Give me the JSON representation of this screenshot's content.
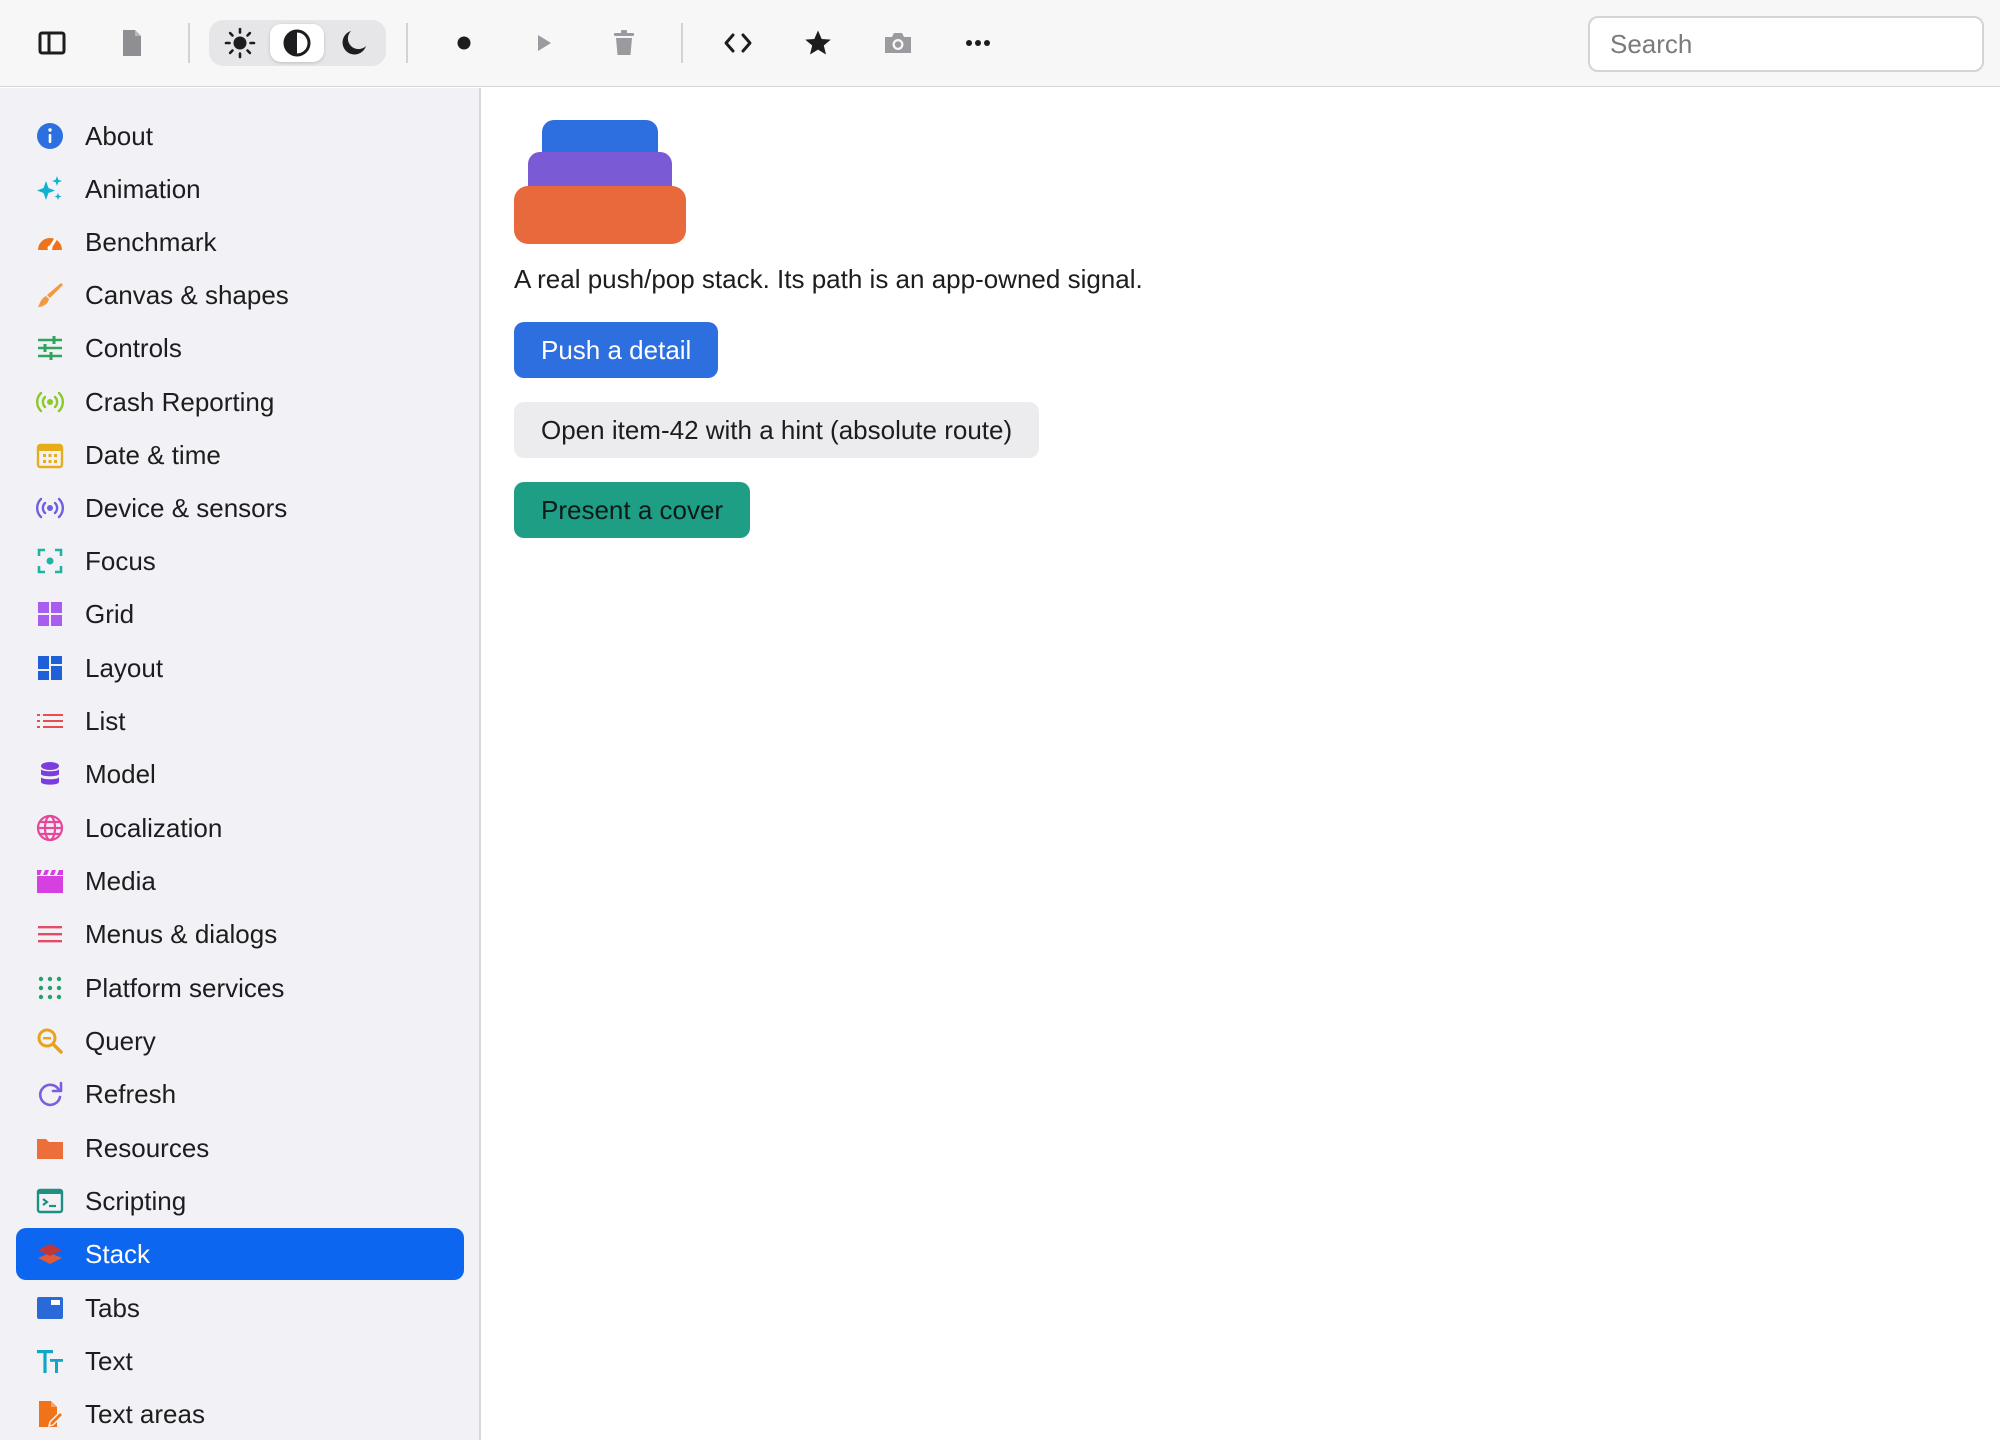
{
  "toolbar": {
    "search_placeholder": "Search",
    "buttons": [
      {
        "name": "sidebar-toggle",
        "icon": "sidebar-icon"
      },
      {
        "name": "document",
        "icon": "document-icon"
      },
      {
        "name": "record",
        "icon": "record-dot-icon"
      },
      {
        "name": "play",
        "icon": "play-icon"
      },
      {
        "name": "delete",
        "icon": "trash-icon"
      },
      {
        "name": "source",
        "icon": "code-brackets-icon"
      },
      {
        "name": "favorite",
        "icon": "star-icon"
      },
      {
        "name": "screenshot",
        "icon": "camera-icon"
      },
      {
        "name": "more",
        "icon": "ellipsis-icon"
      }
    ],
    "theme_options": [
      {
        "name": "light",
        "icon": "sun-icon",
        "selected": false
      },
      {
        "name": "auto",
        "icon": "contrast-icon",
        "selected": true
      },
      {
        "name": "dark",
        "icon": "moon-icon",
        "selected": false
      }
    ]
  },
  "sidebar": {
    "selected_index": 21,
    "items": [
      {
        "label": "About",
        "icon": "info-icon",
        "color": "#2c6fdf"
      },
      {
        "label": "Animation",
        "icon": "sparkles-icon",
        "color": "#12b2cf"
      },
      {
        "label": "Benchmark",
        "icon": "speedometer-icon",
        "color": "#f07219"
      },
      {
        "label": "Canvas & shapes",
        "icon": "paintbrush-icon",
        "color": "#f19a3e"
      },
      {
        "label": "Controls",
        "icon": "sliders-icon",
        "color": "#2ea45c"
      },
      {
        "label": "Crash Reporting",
        "icon": "broadcast-icon",
        "color": "#8ac926"
      },
      {
        "label": "Date & time",
        "icon": "calendar-icon",
        "color": "#e6ad1a"
      },
      {
        "label": "Device & sensors",
        "icon": "sensor-icon",
        "color": "#6d5fe0"
      },
      {
        "label": "Focus",
        "icon": "focus-icon",
        "color": "#20b2a3"
      },
      {
        "label": "Grid",
        "icon": "grid-icon",
        "color": "#a85cf0"
      },
      {
        "label": "Layout",
        "icon": "layout-icon",
        "color": "#1f5fd8"
      },
      {
        "label": "List",
        "icon": "list-icon",
        "color": "#ea4d4d"
      },
      {
        "label": "Model",
        "icon": "database-icon",
        "color": "#7a3de0"
      },
      {
        "label": "Localization",
        "icon": "globe-icon",
        "color": "#e6479a"
      },
      {
        "label": "Media",
        "icon": "clapperboard-icon",
        "color": "#d63fe0"
      },
      {
        "label": "Menus & dialogs",
        "icon": "menu-icon",
        "color": "#e24c6a"
      },
      {
        "label": "Platform services",
        "icon": "dots-grid-icon",
        "color": "#22a36a"
      },
      {
        "label": "Query",
        "icon": "magnifier-icon",
        "color": "#eaa11b"
      },
      {
        "label": "Refresh",
        "icon": "refresh-icon",
        "color": "#7b5fe0"
      },
      {
        "label": "Resources",
        "icon": "folder-icon",
        "color": "#ec6f3b"
      },
      {
        "label": "Scripting",
        "icon": "terminal-icon",
        "color": "#1f8f84"
      },
      {
        "label": "Stack",
        "icon": "layers-icon",
        "color": "#e05a3a"
      },
      {
        "label": "Tabs",
        "icon": "tabs-icon",
        "color": "#2a6ad8"
      },
      {
        "label": "Text",
        "icon": "text-size-icon",
        "color": "#12a6c6"
      },
      {
        "label": "Text areas",
        "icon": "document-edit-icon",
        "color": "#f07219"
      }
    ]
  },
  "main": {
    "illustration": {
      "icon": "stack-layers-illustration",
      "colors": [
        "#2e6fe0",
        "#7b5ad6",
        "#e8693c"
      ]
    },
    "description": "A real push/pop stack. Its path is an app-owned signal.",
    "buttons": {
      "push": "Push a detail",
      "open": "Open item-42 with a hint (absolute route)",
      "present": "Present a cover"
    }
  }
}
